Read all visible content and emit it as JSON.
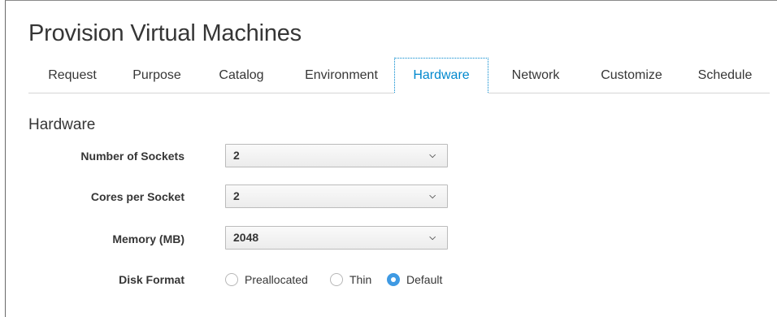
{
  "page": {
    "title": "Provision Virtual Machines"
  },
  "tabs": [
    {
      "label": "Request"
    },
    {
      "label": "Purpose"
    },
    {
      "label": "Catalog"
    },
    {
      "label": "Environment"
    },
    {
      "label": "Hardware",
      "active": true
    },
    {
      "label": "Network"
    },
    {
      "label": "Customize"
    },
    {
      "label": "Schedule"
    }
  ],
  "hardware": {
    "section_title": "Hardware",
    "sockets": {
      "label": "Number of Sockets",
      "value": "2"
    },
    "cores": {
      "label": "Cores per Socket",
      "value": "2"
    },
    "memory": {
      "label": "Memory (MB)",
      "value": "2048"
    },
    "disk_format": {
      "label": "Disk Format",
      "options": [
        {
          "label": "Preallocated",
          "checked": false
        },
        {
          "label": "Thin",
          "checked": false
        },
        {
          "label": "Default",
          "checked": true
        }
      ]
    }
  },
  "colors": {
    "accent": "#0088ce",
    "radio_checked": "#3f9ae3"
  }
}
